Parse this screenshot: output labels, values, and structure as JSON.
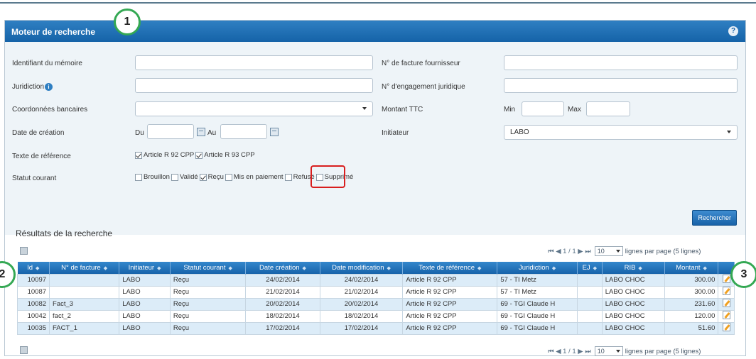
{
  "panel": {
    "title": "Moteur de recherche",
    "help_label": "?"
  },
  "form": {
    "identifiant_label": "Identifiant du mémoire",
    "identifiant_value": "",
    "facture_label": "N° de facture fournisseur",
    "facture_value": "",
    "juridiction_label": "Juridiction",
    "juridiction_value": "",
    "engagement_label": "N° d'engagement juridique",
    "engagement_value": "",
    "coordonnees_label": "Coordonnées bancaires",
    "coordonnees_value": "",
    "montant_label": "Montant TTC",
    "montant_min_label": "Min",
    "montant_max_label": "Max",
    "date_label": "Date de création",
    "date_du_label": "Du",
    "date_au_label": "Au",
    "initiateur_label": "Initiateur",
    "initiateur_value": "LABO",
    "texte_label": "Texte de référence",
    "texte_options": [
      {
        "label": "Article R 92 CPP",
        "checked": true
      },
      {
        "label": "Article R 93 CPP",
        "checked": true
      }
    ],
    "statut_label": "Statut courant",
    "statut_options": [
      {
        "label": "Brouillon",
        "checked": false
      },
      {
        "label": "Validé",
        "checked": false
      },
      {
        "label": "Reçu",
        "checked": true
      },
      {
        "label": "Mis en paiement",
        "checked": false
      },
      {
        "label": "Refusé",
        "checked": false
      },
      {
        "label": "Supprimé",
        "checked": false
      }
    ],
    "search_button": "Rechercher"
  },
  "results": {
    "title": "Résultats de la recherche",
    "pager": {
      "nav": "⏮ ◀ 1 / 1 ▶ ⏭",
      "page_size": "10",
      "suffix": "lignes par page (5 lignes)"
    },
    "columns": [
      "Id",
      "N° de facture",
      "Initiateur",
      "Statut courant",
      "Date création",
      "Date modification",
      "Texte de référence",
      "Juridiction",
      "EJ",
      "RIB",
      "Montant",
      ""
    ],
    "rows": [
      [
        "10097",
        "",
        "LABO",
        "Reçu",
        "24/02/2014",
        "24/02/2014",
        "Article R 92 CPP",
        "57 - TI Metz",
        "",
        "LABO CHOC",
        "300.00"
      ],
      [
        "10087",
        "",
        "LABO",
        "Reçu",
        "21/02/2014",
        "21/02/2014",
        "Article R 92 CPP",
        "57 - TI Metz",
        "",
        "LABO CHOC",
        "300.00"
      ],
      [
        "10082",
        "Fact_3",
        "LABO",
        "Reçu",
        "20/02/2014",
        "20/02/2014",
        "Article R 92 CPP",
        "69 - TGI Claude H",
        "",
        "LABO CHOC",
        "231.60"
      ],
      [
        "10042",
        "fact_2",
        "LABO",
        "Reçu",
        "18/02/2014",
        "18/02/2014",
        "Article R 92 CPP",
        "69 - TGI Claude H",
        "",
        "LABO CHOC",
        "120.00"
      ],
      [
        "10035",
        "FACT_1",
        "LABO",
        "Reçu",
        "17/02/2014",
        "17/02/2014",
        "Article R 92 CPP",
        "69 - TGI Claude H",
        "",
        "LABO CHOC",
        "51.60"
      ]
    ]
  },
  "callouts": [
    "1",
    "2",
    "3"
  ],
  "colors": {
    "header": "#1563a8",
    "accent_green": "#34a853",
    "highlight_red": "#d81e1e",
    "row_even": "#dcecf8"
  }
}
